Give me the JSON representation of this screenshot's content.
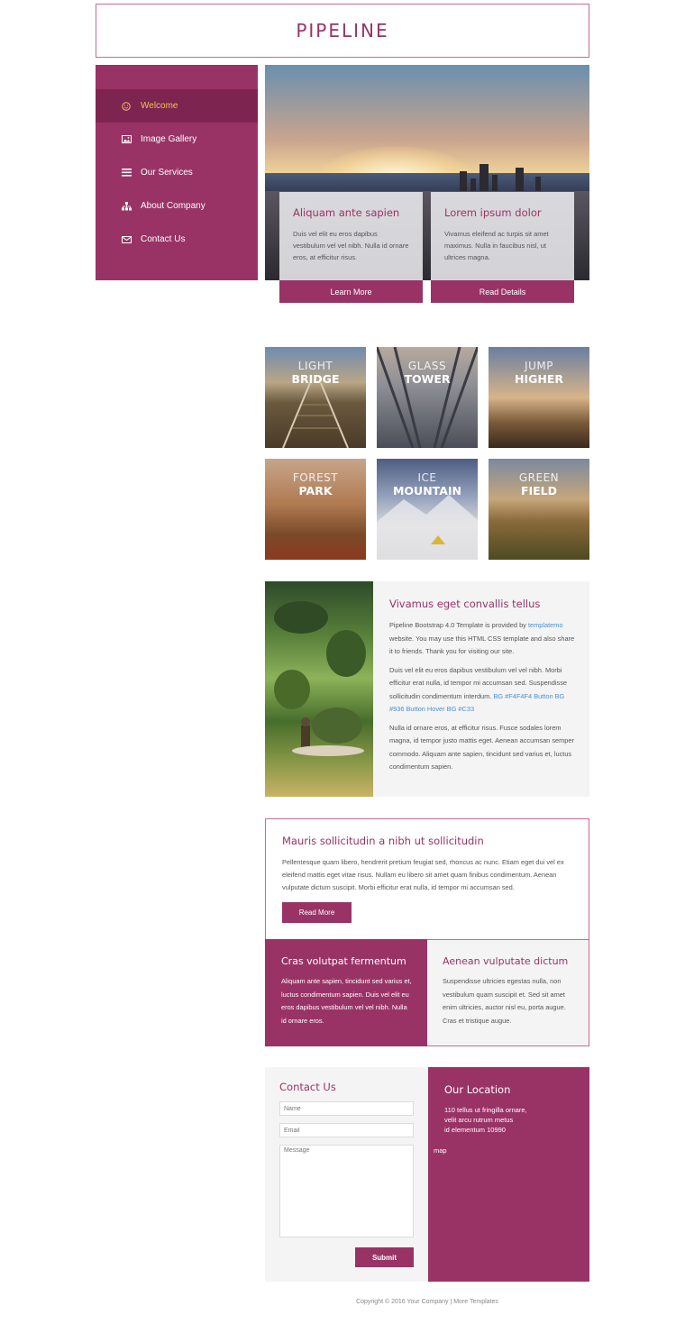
{
  "site": {
    "title": "PIPELINE"
  },
  "nav": {
    "items": [
      {
        "label": "Welcome",
        "icon": "smile-icon",
        "active": true
      },
      {
        "label": "Image Gallery",
        "icon": "image-icon"
      },
      {
        "label": "Our Services",
        "icon": "list-icon"
      },
      {
        "label": "About Company",
        "icon": "sitemap-icon"
      },
      {
        "label": "Contact Us",
        "icon": "envelope-icon"
      }
    ]
  },
  "hero": {
    "cards": [
      {
        "title": "Aliquam ante sapien",
        "text": "Duis vel elit eu eros dapibus vestibulum vel vel nibh. Nulla id ornare eros, at efficitur risus.",
        "button": "Learn More"
      },
      {
        "title": "Lorem ipsum dolor",
        "text": "Vivamus eleifend ac turpis sit amet maximus. Nulla in faucibus nisl, ut ultrices magna.",
        "button": "Read Details"
      }
    ]
  },
  "gallery": {
    "tiles": [
      {
        "line1": "LIGHT",
        "line2": "BRIDGE"
      },
      {
        "line1": "GLASS",
        "line2": "TOWER"
      },
      {
        "line1": "JUMP",
        "line2": "HIGHER"
      },
      {
        "line1": "FOREST",
        "line2": "PARK"
      },
      {
        "line1": "ICE",
        "line2": "MOUNTAIN"
      },
      {
        "line1": "GREEN",
        "line2": "FIELD"
      }
    ]
  },
  "info": {
    "title": "Vivamus eget convallis tellus",
    "p1_pre": "Pipeline Bootstrap 4.0 Template is provided by ",
    "p1_link": "templatemo",
    "p1_post": " website. You may use this HTML CSS template and also share it to friends. Thank you for visiting our site.",
    "p2_pre": "Duis vel elit eu eros dapibus vestibulum vel vel nibh. Morbi efficitur erat nulla, id tempor mi accumsan sed. Suspendisse sollicitudin condimentum interdum. ",
    "p2_link": "BG #F4F4F4 Button BG #936 Button Hover BG #C33",
    "p3": "Nulla id ornare eros, at efficitur risus. Fusce sodales lorem magna, id tempor justo mattis eget. Aenean accumsan semper commodo. Aliquam ante sapien, tincidunt sed varius et, luctus condimentum sapien."
  },
  "mauris": {
    "title": "Mauris sollicitudin a nibh ut sollicitudin",
    "text": "Pellentesque quam libero, hendrerit pretium feugiat sed, rhoncus ac nunc. Etiam eget dui vel ex eleifend mattis eget vitae risus. Nullam eu libero sit amet quam finibus condimentum. Aenean vulputate dictum suscipit. Morbi efficitur erat nulla, id tempor mi accumsan sed.",
    "button": "Read More"
  },
  "cras": {
    "title": "Cras volutpat fermentum",
    "text": "Aliquam ante sapien, tincidunt sed varius et, luctus condimentum sapien. Duis vel elit eu eros dapibus vestibulum vel vel nibh. Nulla id ornare eros."
  },
  "aenean": {
    "title": "Aenean vulputate dictum",
    "text": "Suspendisse ultricies egestas nulla, non vestibulum quam suscipit et. Sed sit amet enim ultricies, auctor nisl eu, porta augue. Cras et tristique augue."
  },
  "contact": {
    "title": "Contact Us",
    "name_placeholder": "Name",
    "email_placeholder": "Email",
    "message_placeholder": "Message",
    "submit": "Submit"
  },
  "location": {
    "title": "Our Location",
    "address_line1": "110 tellus ut fringilla ornare,",
    "address_line2": "velit arcu rutrum metus",
    "address_line3": "id elementum 10990",
    "map_label": "map"
  },
  "footer": {
    "text": "Copyright © 2016 Your Company | More Templates"
  },
  "colors": {
    "brand": "#993366",
    "brand_dark": "#7e2450",
    "active_text": "#f0c05a",
    "panel_bg": "#f4f4f4",
    "link": "#4a8fd1"
  }
}
